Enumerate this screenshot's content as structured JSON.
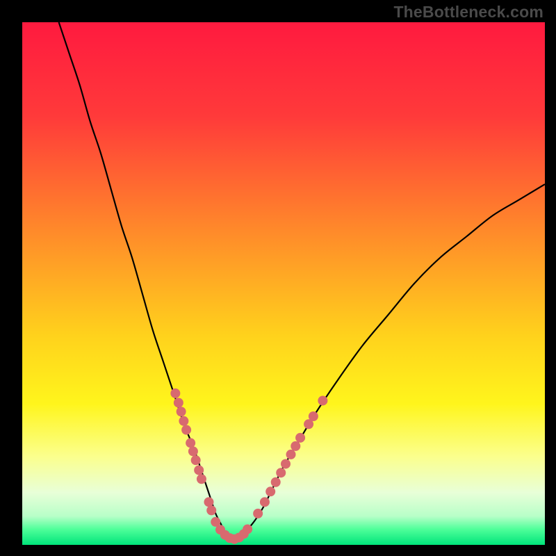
{
  "watermark": "TheBottleneck.com",
  "chart_data": {
    "type": "line",
    "title": "",
    "xlabel": "",
    "ylabel": "",
    "xlim": [
      0,
      100
    ],
    "ylim": [
      0,
      100
    ],
    "gradient_stops": [
      {
        "offset": 0.0,
        "color": "#ff1a3f"
      },
      {
        "offset": 0.18,
        "color": "#ff3a3a"
      },
      {
        "offset": 0.4,
        "color": "#ff8a2a"
      },
      {
        "offset": 0.6,
        "color": "#ffd21c"
      },
      {
        "offset": 0.73,
        "color": "#fff51c"
      },
      {
        "offset": 0.83,
        "color": "#fbff8c"
      },
      {
        "offset": 0.9,
        "color": "#e8ffd8"
      },
      {
        "offset": 0.945,
        "color": "#b8ffc8"
      },
      {
        "offset": 0.97,
        "color": "#4fff9a"
      },
      {
        "offset": 1.0,
        "color": "#00e47a"
      }
    ],
    "series": [
      {
        "name": "bottleneck-curve",
        "x": [
          7,
          9,
          11,
          13,
          15,
          17,
          19,
          21,
          23,
          25,
          27,
          29,
          31,
          33,
          35,
          36,
          37,
          38,
          39,
          40,
          41,
          42,
          44,
          46,
          48,
          50,
          53,
          56,
          60,
          65,
          70,
          75,
          80,
          85,
          90,
          95,
          100
        ],
        "y": [
          100,
          94,
          88,
          81,
          75,
          68,
          61,
          55,
          48,
          41,
          35,
          29,
          23,
          18,
          12,
          9,
          6,
          4,
          2,
          1,
          1,
          2,
          4,
          7,
          11,
          15,
          20,
          25,
          31,
          38,
          44,
          50,
          55,
          59,
          63,
          66,
          69
        ]
      }
    ],
    "highlight_points": {
      "name": "dotted-highlight",
      "color": "#d86a6f",
      "radius": 7,
      "points": [
        {
          "x": 29.3,
          "y": 29.0
        },
        {
          "x": 29.9,
          "y": 27.2
        },
        {
          "x": 30.4,
          "y": 25.5
        },
        {
          "x": 30.9,
          "y": 23.7
        },
        {
          "x": 31.4,
          "y": 22.0
        },
        {
          "x": 32.2,
          "y": 19.5
        },
        {
          "x": 32.7,
          "y": 17.9
        },
        {
          "x": 33.2,
          "y": 16.2
        },
        {
          "x": 33.8,
          "y": 14.3
        },
        {
          "x": 34.3,
          "y": 12.6
        },
        {
          "x": 35.7,
          "y": 8.2
        },
        {
          "x": 36.2,
          "y": 6.6
        },
        {
          "x": 37.0,
          "y": 4.4
        },
        {
          "x": 37.9,
          "y": 2.9
        },
        {
          "x": 38.8,
          "y": 1.9
        },
        {
          "x": 39.7,
          "y": 1.3
        },
        {
          "x": 40.6,
          "y": 1.1
        },
        {
          "x": 41.5,
          "y": 1.4
        },
        {
          "x": 42.4,
          "y": 2.1
        },
        {
          "x": 43.1,
          "y": 3.0
        },
        {
          "x": 45.1,
          "y": 6.0
        },
        {
          "x": 46.4,
          "y": 8.2
        },
        {
          "x": 47.5,
          "y": 10.2
        },
        {
          "x": 48.5,
          "y": 12.0
        },
        {
          "x": 49.5,
          "y": 13.8
        },
        {
          "x": 50.4,
          "y": 15.5
        },
        {
          "x": 51.4,
          "y": 17.3
        },
        {
          "x": 52.3,
          "y": 18.9
        },
        {
          "x": 53.2,
          "y": 20.5
        },
        {
          "x": 54.8,
          "y": 23.1
        },
        {
          "x": 55.7,
          "y": 24.6
        },
        {
          "x": 57.5,
          "y": 27.6
        }
      ]
    }
  }
}
